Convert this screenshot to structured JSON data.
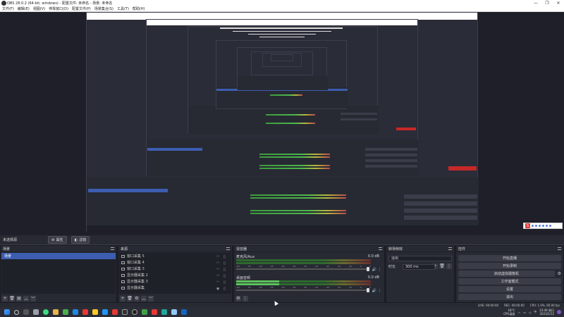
{
  "window": {
    "title": "OBS 28.0.2 (64-bit, windows) - 配置文件: 未命名 - 场景: 未命名",
    "controls": [
      "—",
      "❐",
      "✕"
    ]
  },
  "menu": [
    "文件(F)",
    "编辑(E)",
    "视图(V)",
    "停靠窗口(D)",
    "配置文件(P)",
    "场景集合(S)",
    "工具(T)",
    "帮助(H)"
  ],
  "preview_bar": {
    "label": "未选择源",
    "properties": "属性",
    "filters": "滤镜"
  },
  "scenes": {
    "header": "场景",
    "items": [
      "场景"
    ]
  },
  "sources": {
    "header": "来源",
    "items": [
      "窗口采集 5",
      "窗口采集 4",
      "窗口采集 3",
      "显示器采集 2",
      "显示器采集 3",
      "显示器采集"
    ]
  },
  "mixer": {
    "header": "混音器",
    "channels": [
      {
        "name": "麦克风/Aux",
        "db": "0.0 dB"
      },
      {
        "name": "桌面音频",
        "db": "0.0 dB"
      }
    ],
    "ticks": [
      "-60",
      "-55",
      "-50",
      "-45",
      "-40",
      "-35",
      "-30",
      "-25",
      "-20",
      "-15",
      "-10",
      "-5",
      "0"
    ]
  },
  "transitions": {
    "header": "转场特效",
    "type": "淡出",
    "duration_label": "时长",
    "duration_value": "300 ms"
  },
  "controls": {
    "header": "控件",
    "buttons": [
      "开始直播",
      "开始录制",
      "启动虚拟摄像机",
      "工作室模式",
      "设置",
      "退出"
    ]
  },
  "status": {
    "live": "LIVE: 00:00:00",
    "rec": "REC: 00:00:00",
    "cpu": "CPU: 1.0%, 60.00 fps"
  },
  "taskbar": {
    "weather_temp": "18°C",
    "weather_label": "CPU温度",
    "time": "23:49 周日",
    "date": "2023/2/12",
    "lang": "中"
  },
  "ime": {
    "label": "S"
  },
  "colors": {
    "accent": "#3c5db0",
    "bg": "#1e1f29",
    "panel": "#272a33"
  }
}
